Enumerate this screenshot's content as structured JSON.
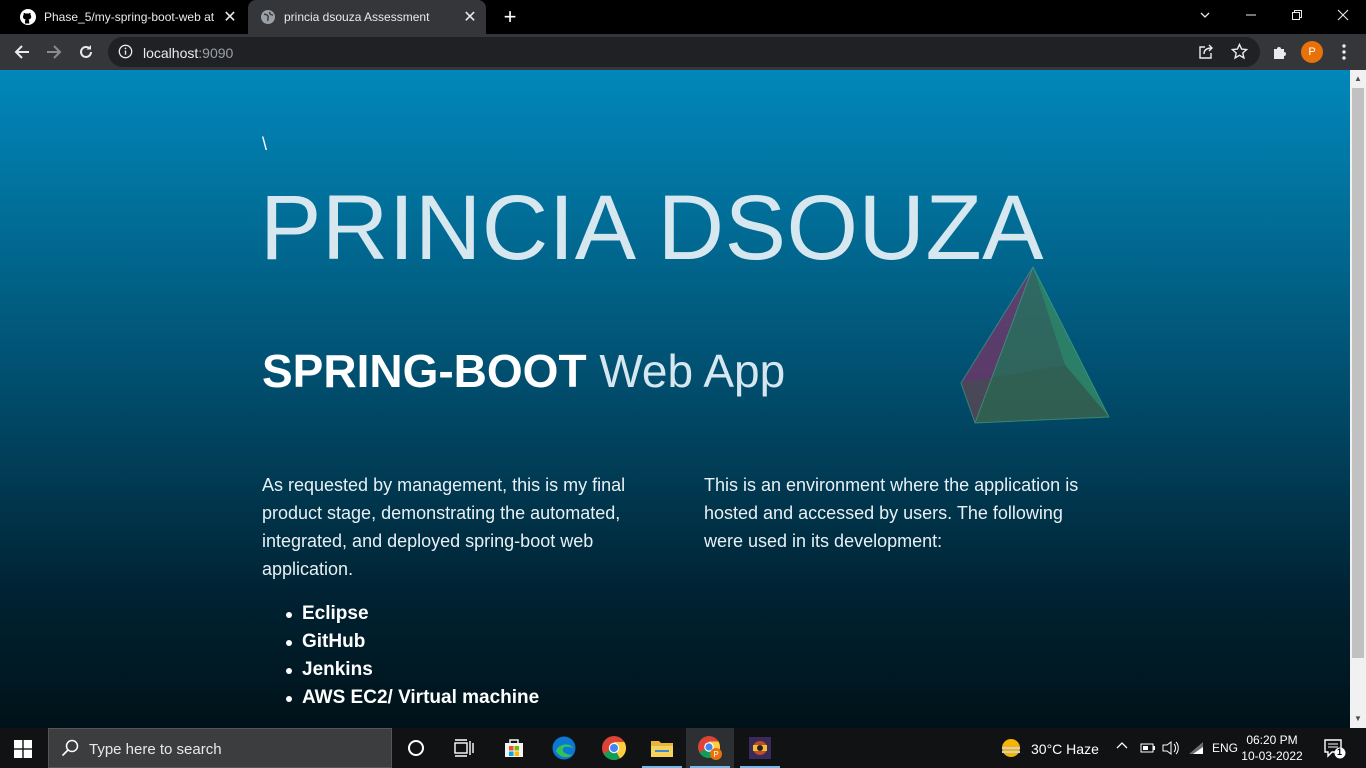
{
  "browser": {
    "tabs": [
      {
        "title": "Phase_5/my-spring-boot-web at",
        "favicon": "github-icon",
        "active": false
      },
      {
        "title": "princia dsouza Assessment",
        "favicon": "globe-icon",
        "active": true
      }
    ],
    "address": {
      "host": "localhost",
      "port": ":9090"
    },
    "profile_initial": "P",
    "accent": "#e8710a"
  },
  "page": {
    "stray_char": "\\",
    "name": "PRINCIA DSOUZA",
    "subtitle_bold": "SPRING-BOOT",
    "subtitle_light": " Web App",
    "left_paragraph": "As requested by management, this is my final product stage, demonstrating the automated, integrated, and deployed spring-boot web application.",
    "right_paragraph": "This is an environment where the application is hosted and accessed by users. The following were used in its development:",
    "tools": [
      "Eclipse",
      "GitHub",
      "Jenkins",
      "AWS EC2/ Virtual machine"
    ],
    "gradient_top": "#0187bb",
    "gradient_bottom": "#001219"
  },
  "taskbar": {
    "search_placeholder": "Type here to search",
    "weather": "30°C  Haze",
    "language": "ENG",
    "time": "06:20 PM",
    "date": "10-03-2022",
    "notification_count": "1"
  }
}
